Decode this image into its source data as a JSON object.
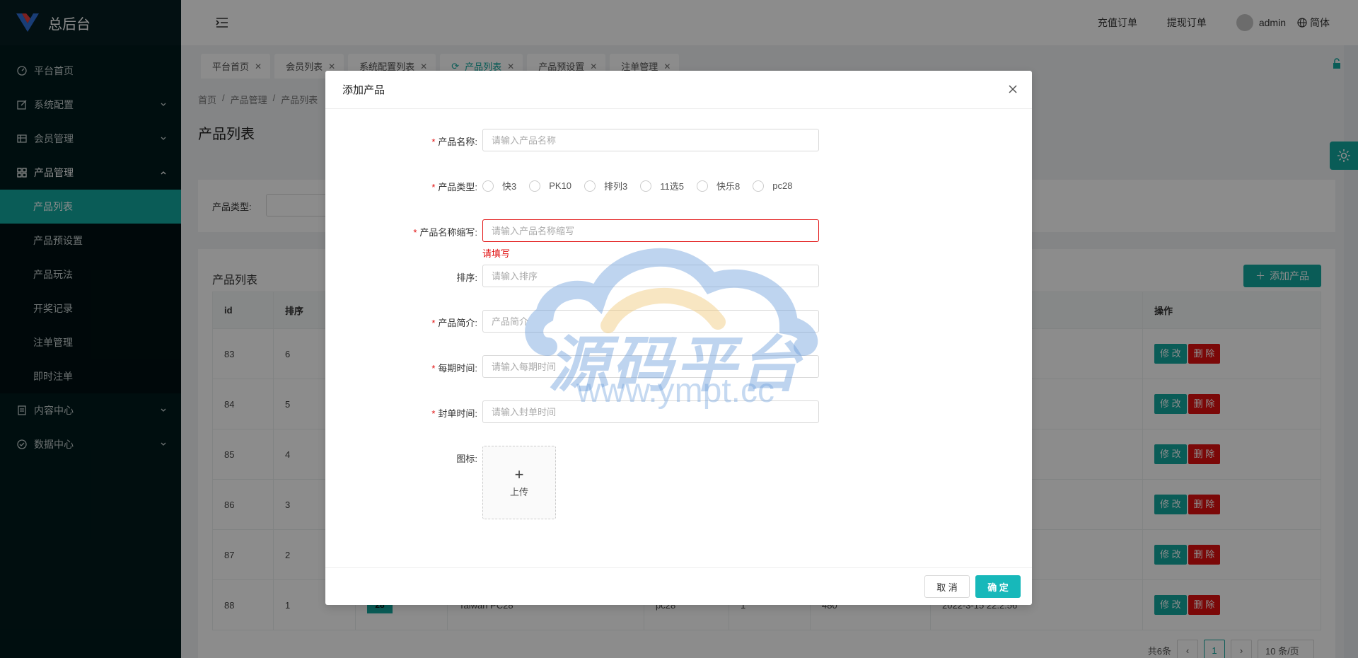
{
  "app": {
    "title": "总后台"
  },
  "sidebar": {
    "items": [
      {
        "label": "平台首页",
        "icon": "dashboard-icon"
      },
      {
        "label": "系统配置",
        "icon": "edit-icon"
      },
      {
        "label": "会员管理",
        "icon": "table-icon"
      },
      {
        "label": "产品管理",
        "icon": "grid-icon"
      }
    ],
    "sub_items": [
      {
        "label": "产品列表"
      },
      {
        "label": "产品预设置"
      },
      {
        "label": "产品玩法"
      },
      {
        "label": "开奖记录"
      },
      {
        "label": "注单管理"
      },
      {
        "label": "即时注单"
      }
    ],
    "items_after": [
      {
        "label": "内容中心",
        "icon": "doc-icon"
      },
      {
        "label": "数据中心",
        "icon": "check-circle-icon"
      }
    ]
  },
  "header": {
    "recharge": "充值订单",
    "withdraw": "提现订单",
    "user": "admin",
    "lang": "简体"
  },
  "tabs": [
    {
      "label": "平台首页"
    },
    {
      "label": "会员列表"
    },
    {
      "label": "系统配置列表"
    },
    {
      "label": "产品列表"
    },
    {
      "label": "产品预设置"
    },
    {
      "label": "注单管理"
    }
  ],
  "breadcrumb": [
    "首页",
    "产品管理",
    "产品列表"
  ],
  "page": {
    "title": "产品列表",
    "filter_label": "产品类型:",
    "table_title": "产品列表",
    "add_button": "添加产品"
  },
  "table": {
    "headers": [
      "id",
      "排序",
      "操作"
    ],
    "rows": [
      {
        "id": "83",
        "sort": "6"
      },
      {
        "id": "84",
        "sort": "5"
      },
      {
        "id": "85",
        "sort": "4"
      },
      {
        "id": "86",
        "sort": "3"
      },
      {
        "id": "87",
        "sort": "2"
      },
      {
        "id": "88",
        "sort": "1",
        "name": "Taiwan PC28",
        "code": "pc28",
        "c1": "1",
        "c2": "480",
        "time": "2022-3-15 22:2:56"
      }
    ],
    "edit": "修 改",
    "delete": "删 除",
    "pager": {
      "total": "共6条",
      "page": "1",
      "size": "10 条/页"
    }
  },
  "modal": {
    "title": "添加产品",
    "fields": {
      "name": {
        "label": "产品名称:",
        "placeholder": "请输入产品名称"
      },
      "type": {
        "label": "产品类型:",
        "options": [
          "快3",
          "PK10",
          "排列3",
          "11选5",
          "快乐8",
          "pc28"
        ]
      },
      "abbr": {
        "label": "产品名称缩写:",
        "placeholder": "请输入产品名称缩写",
        "error": "请填写"
      },
      "sort": {
        "label": "排序:",
        "placeholder": "请输入排序"
      },
      "intro": {
        "label": "产品简介:",
        "placeholder": "产品简介"
      },
      "period": {
        "label": "每期时间:",
        "placeholder": "请输入每期时间"
      },
      "close": {
        "label": "封单时间:",
        "placeholder": "请输入封单时间"
      },
      "icon": {
        "label": "图标:",
        "upload": "上传"
      }
    },
    "cancel": "取 消",
    "ok": "确 定"
  },
  "watermark": {
    "text": "源码平台",
    "url": "www.ympt.cc"
  },
  "colors": {
    "accent": "#13a89e",
    "danger": "#e10f0f",
    "sidebar": "#011a1c"
  }
}
